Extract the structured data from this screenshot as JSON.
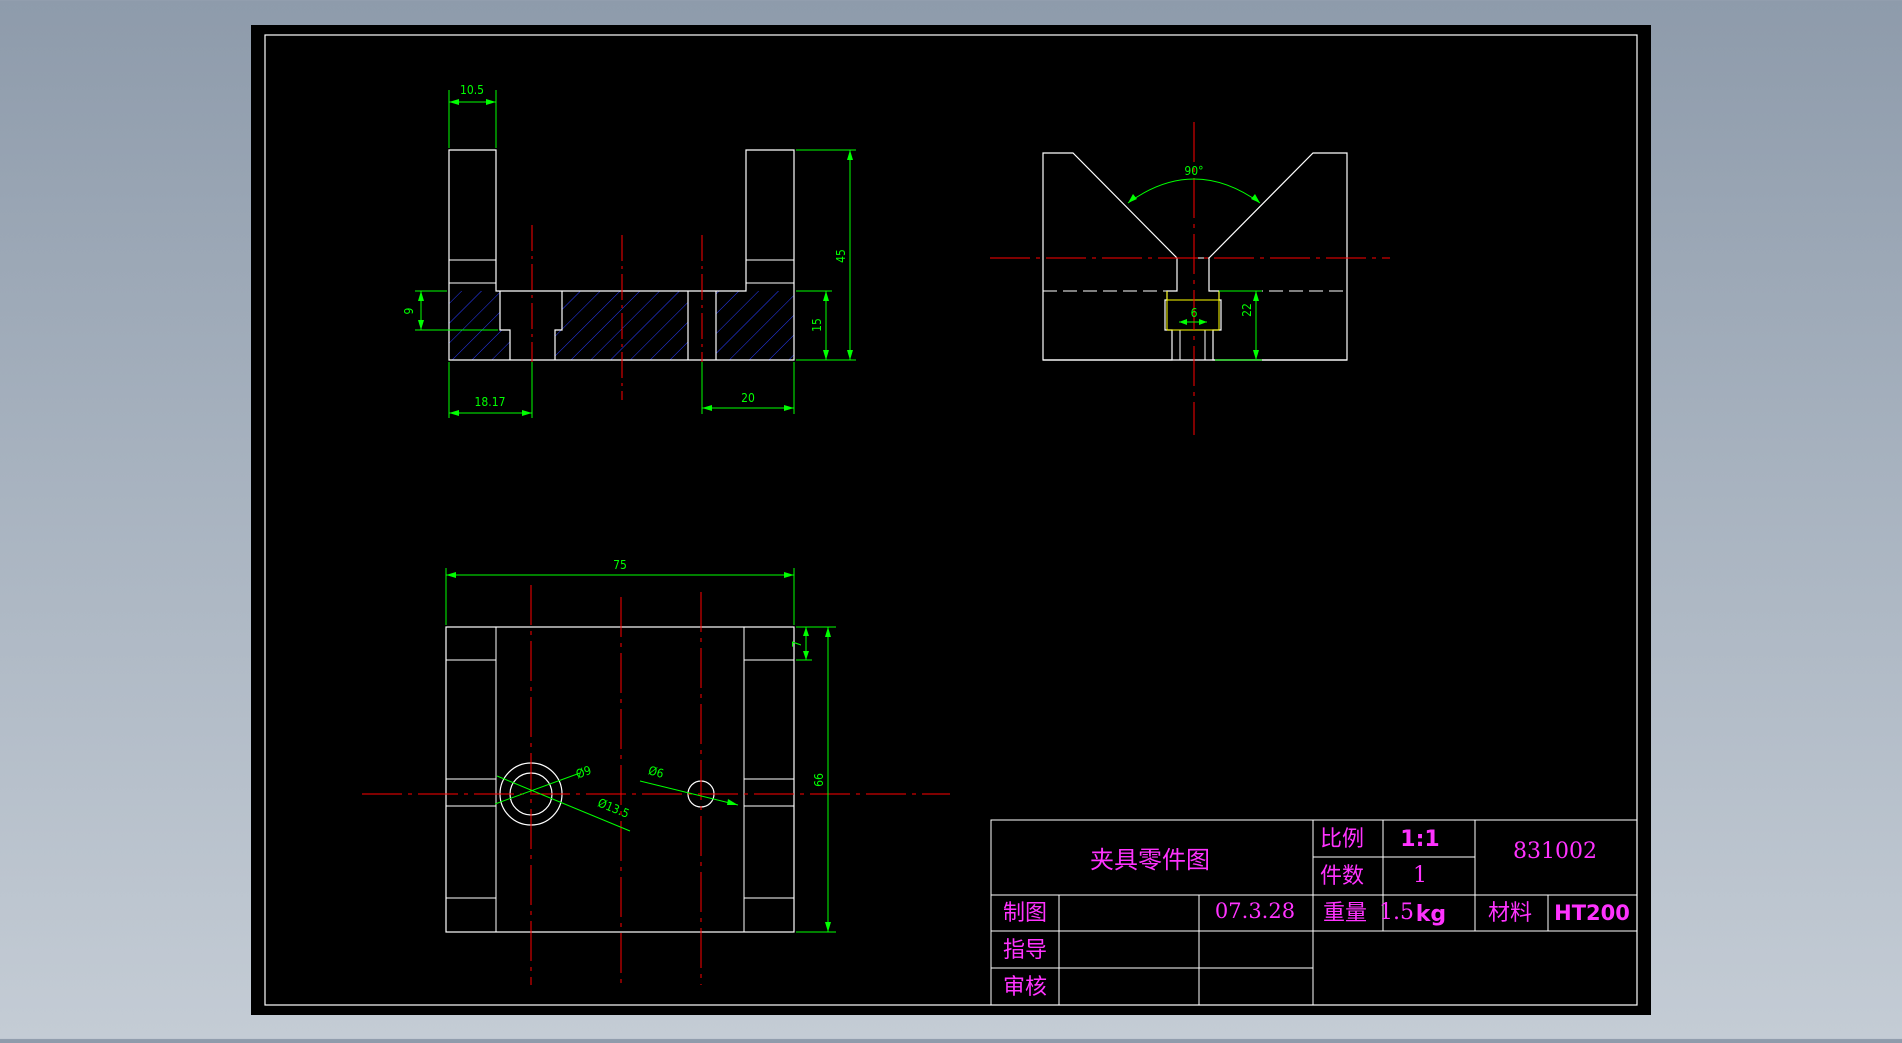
{
  "drawing": {
    "dimensions": {
      "width_top": "10.5",
      "height_45": "45",
      "height_9": "9",
      "height_15": "15",
      "width_18_17": "18.17",
      "width_20": "20",
      "angle_90": "90°",
      "width_6": "6",
      "height_22": "22",
      "width_75": "75",
      "height_7": "7",
      "height_66": "66",
      "dia_9": "Ø9",
      "dia_13_5": "Ø13.5",
      "dia_6": "Ø6"
    }
  },
  "title_block": {
    "part_name": "夹具零件图",
    "scale_label": "比例",
    "scale_value": "1:1",
    "quantity_label": "件数",
    "quantity_value": "1",
    "drawing_number": "831002",
    "drawn_by_label": "制图",
    "date": "07.3.28",
    "weight_label": "重量",
    "weight_value": "1.5",
    "weight_unit": "kg",
    "material_label": "材料",
    "material_value": "HT200",
    "guided_by_label": "指导",
    "reviewed_by_label": "审核"
  },
  "colors": {
    "paper": "#000000",
    "outline": "#ffffff",
    "dimension": "#00ff00",
    "centerline": "#ff0000",
    "hatch": "#0000ff",
    "hidden_line": "#ffff00",
    "title_text": "#ff00ff"
  }
}
